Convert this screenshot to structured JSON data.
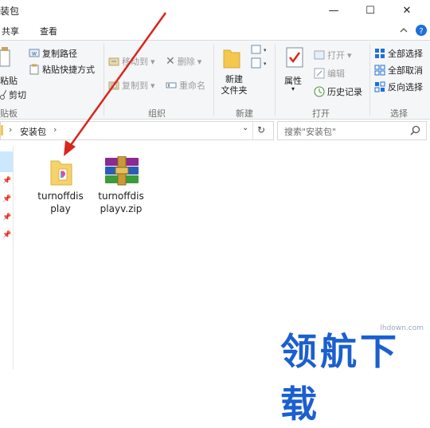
{
  "window": {
    "title": "装包",
    "min": "—",
    "max": "☐",
    "close": "✕"
  },
  "tabs": [
    "共享",
    "查看"
  ],
  "ribbon": {
    "clipboard": {
      "paste": "粘贴",
      "copy_path": "复制路径",
      "paste_shortcut": "粘贴快捷方式",
      "cut": "剪切",
      "label": "贴板"
    },
    "organize": {
      "move_to": "移动到",
      "copy_to": "复制到",
      "delete": "删除",
      "rename": "重命名",
      "label": "组织"
    },
    "new": {
      "new_folder": "新建\n文件夹",
      "label": "新建"
    },
    "open": {
      "properties": "属性",
      "open": "打开",
      "edit": "编辑",
      "history": "历史记录",
      "label": "打开"
    },
    "select": {
      "select_all": "全部选择",
      "select_none": "全部取消",
      "invert": "反向选择",
      "label": "选择"
    }
  },
  "address": {
    "crumb": "安装包",
    "search_placeholder": "搜索\"安装包\""
  },
  "files": [
    {
      "name_line1": "turnoffdis",
      "name_line2": "play",
      "type": "folder"
    },
    {
      "name_line1": "turnoffdis",
      "name_line2": "playv.zip",
      "type": "winrar-archive"
    }
  ],
  "watermark": {
    "url": "lhdown.com",
    "logo": "领航下载"
  },
  "colors": {
    "accent": "#1b5fd0",
    "arrow": "#d9261c",
    "selection": "#cce8ff"
  }
}
